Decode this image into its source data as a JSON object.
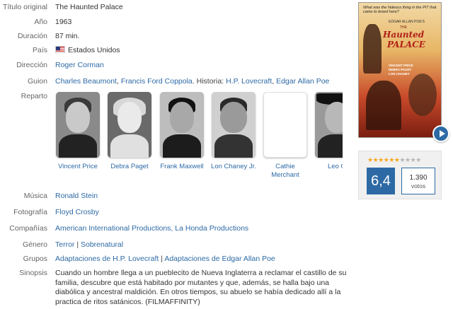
{
  "labels": {
    "original_title": "Título original",
    "year": "Año",
    "duration": "Duración",
    "country": "País",
    "director": "Dirección",
    "screenplay": "Guion",
    "cast": "Reparto",
    "music": "Música",
    "photography": "Fotografía",
    "companies": "Compañías",
    "genre": "Género",
    "groups": "Grupos",
    "synopsis": "Sinopsis"
  },
  "movie": {
    "original_title": "The Haunted Palace",
    "year": "1963",
    "duration": "87 min.",
    "country": "Estados Unidos",
    "director": "Roger Corman",
    "screenplay_writers": [
      "Charles Beaumont",
      "Francis Ford Coppola"
    ],
    "screenplay_story_prefix": "Historia:",
    "screenplay_story": [
      "H.P. Lovecraft",
      "Edgar Allan Poe"
    ],
    "music": "Ronald Stein",
    "photography": "Floyd Crosby",
    "companies": [
      "American International Productions",
      "La Honda Productions"
    ],
    "genres": [
      "Terror",
      "Sobrenatural"
    ],
    "groups": [
      "Adaptaciones de H.P. Lovecraft",
      "Adaptaciones de Edgar Allan Poe"
    ],
    "synopsis": "Cuando un hombre llega a un pueblecito de Nueva Inglaterra a reclamar el castillo de su familia, descubre que está habitado por mutantes y que, además, se halla bajo una diabólica y ancestral maldición. En otros tiempos, su abuelo se había dedicado allí a la practica de ritos satánicos. (FILMAFFINITY)"
  },
  "cast": [
    {
      "name": "Vincent Price",
      "has_photo": true
    },
    {
      "name": "Debra Paget",
      "has_photo": true
    },
    {
      "name": "Frank Maxwell",
      "has_photo": true
    },
    {
      "name": "Lon Chaney Jr.",
      "has_photo": true
    },
    {
      "name": "Cathie Merchant",
      "has_photo": false
    },
    {
      "name": "Leo G",
      "has_photo": true
    }
  ],
  "poster": {
    "tagline": "What was the hideous thing in the PIT that came to breed here?",
    "author": "EDGAR ALLAN POE'S",
    "title_the": "THE",
    "title_1": "Haunted",
    "title_2": "PALACE",
    "cast_lines": [
      "VINCENT PRICE",
      "DEBRA PAGET",
      "LON CHANEY"
    ]
  },
  "rating": {
    "score": "6,4",
    "votes": "1.390",
    "votes_label": "votos",
    "stars_filled": 6.4,
    "stars_total": 10
  },
  "colors": {
    "link": "#2d6aa5",
    "accent": "#2d6aa5",
    "star_on": "#f5a623",
    "star_off": "#b5b5b5"
  }
}
